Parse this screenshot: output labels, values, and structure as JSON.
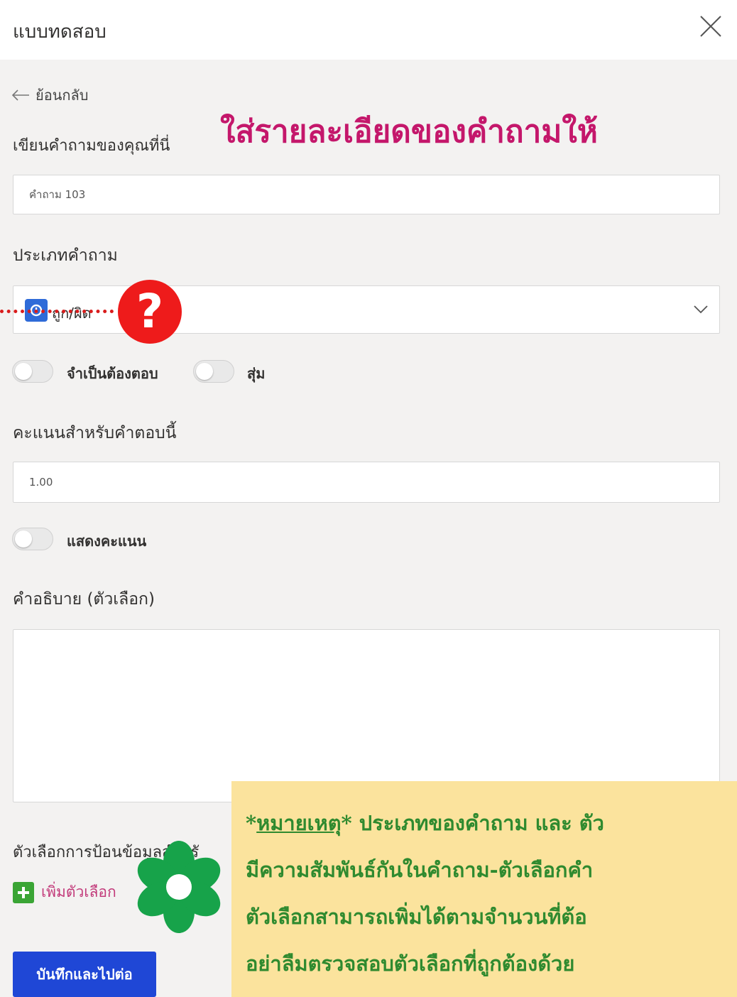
{
  "header": {
    "title": "แบบทดสอบ"
  },
  "nav": {
    "back_label": "ย้อนกลับ"
  },
  "question": {
    "label": "เขียนคำถามของคุณที่นี่",
    "value": "คำถาม 103"
  },
  "annotation": {
    "title": "ใส่รายละเอียดของคำถามให้",
    "note_prefix": "*",
    "note_word": "หมายเหตุ",
    "note_line1_rest": "* ประเภทของคำถาม และ ตัว",
    "note_line2": "มีความสัมพันธ์กันในคำถาม-ตัวเลือกคำ",
    "note_line3": "ตัวเลือกสามารถเพิ่มได้ตามจำนวนที่ต้อ",
    "note_line4": "อย่าลืมตรวจสอบตัวเลือกที่ถูกต้องด้วย",
    "question_mark": "?"
  },
  "question_type": {
    "label": "ประเภทคำถาม",
    "selected": "ถูก/ผิด"
  },
  "toggles": {
    "required": "จำเป็นต้องตอบ",
    "shuffle": "สุ่ม",
    "show_points": "แสดงคะแนน"
  },
  "points": {
    "label": "คะแนนสำหรับคำตอบนี้",
    "value": "1.00"
  },
  "description": {
    "label": "คำอธิบาย (ตัวเลือก)"
  },
  "input_options": {
    "label": "ตัวเลือกการป้อนข้อมูลสำหรั",
    "add_label": "เพิ่มตัวเลือก"
  },
  "actions": {
    "save_label": "บันทึกและไปต่อ"
  },
  "colors": {
    "accent_blue": "#1f47d6",
    "annotation_pink": "#c4176b",
    "note_green": "#2f8a2f",
    "note_bg": "#fbe39d",
    "flower_green": "#17a34a",
    "question_red": "#ee1b1b"
  }
}
